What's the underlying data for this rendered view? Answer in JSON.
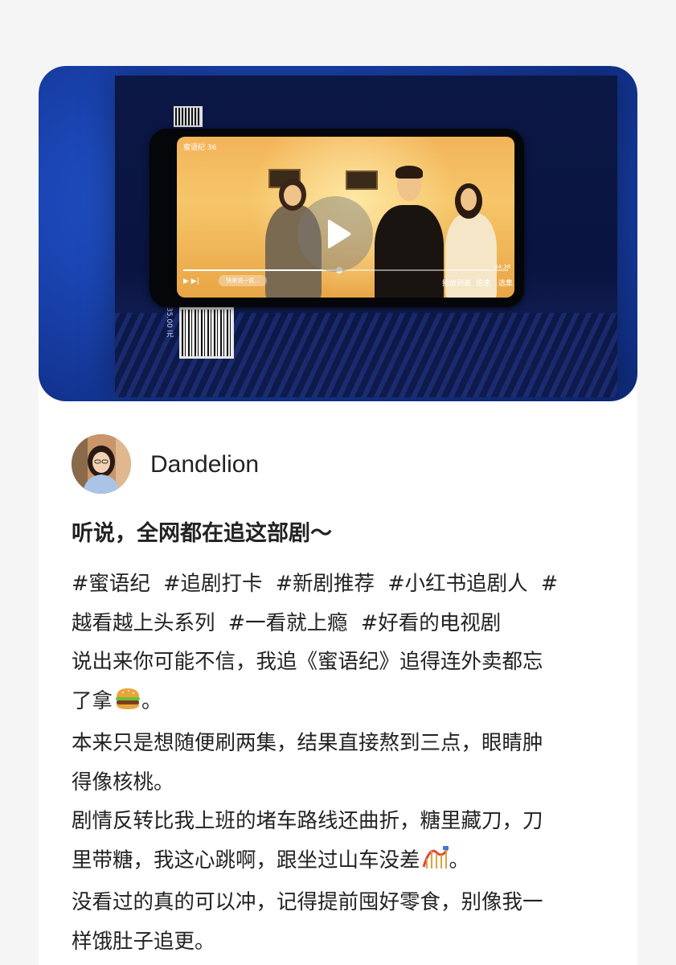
{
  "post": {
    "author": {
      "name": "Dandelion"
    },
    "title": "听说，全网都在追这部剧～",
    "tag_lines": [
      [
        "#蜜语纪",
        "#追剧打卡",
        "#新剧推荐",
        "#小红书追剧人",
        "#"
      ],
      [
        "越看越上头系列",
        "#一看就上瘾",
        "#好看的电视剧"
      ]
    ],
    "body_lines": [
      "说出来你可能不信，我追《蜜语纪》追得连外卖都忘",
      "了拿",
      "。",
      "本来只是想随便刷两集，结果直接熬到三点，眼睛肿",
      "得像核桃。",
      "剧情反转比我上班的堵车路线还曲折，糖里藏刀，刀",
      "里带糖，我这心跳啊，跟坐过山车没差",
      "。",
      "没看过的真的可以冲，记得提前囤好零食，别像我一",
      "样饿肚子追更。"
    ],
    "emojis": {
      "line2": "hamburger-emoji",
      "line7": "roller-coaster-emoji"
    }
  },
  "video": {
    "in_video_title": "蜜语纪 36",
    "in_video_time": "44:38",
    "in_video_controls": [
      "播放列表",
      "倍速",
      "选集"
    ],
    "in_video_input": "快来说一说...",
    "price_text": "35.00 元",
    "play_icon": "play-icon"
  },
  "colors": {
    "background": "#f5f5f5",
    "card": "#ffffff",
    "text": "#222222",
    "video_blue": "#1b46b5",
    "screen_gold": "#f3b45a"
  }
}
